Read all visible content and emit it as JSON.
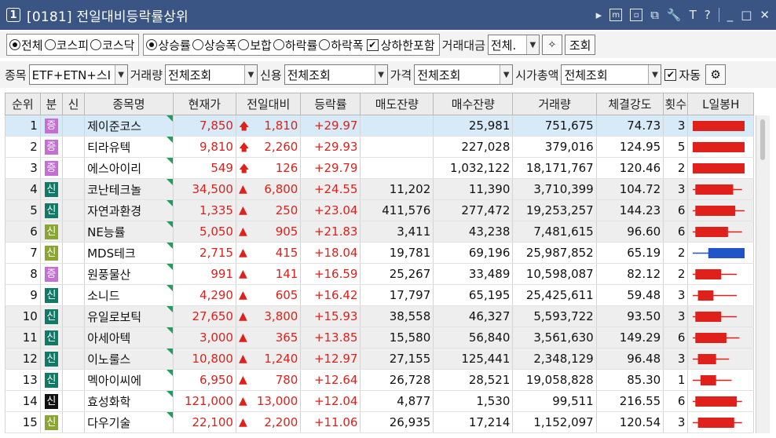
{
  "window": {
    "num": "1",
    "title": "[0181] 전일대비등락률상위"
  },
  "title_icons": [
    "▸",
    "m",
    "▫",
    "⧉",
    "🔧",
    "T",
    "?",
    "_",
    "□",
    "✕"
  ],
  "market": {
    "options": [
      "전체",
      "코스피",
      "코스닥"
    ],
    "selected": 0
  },
  "mode": {
    "options": [
      "상승률",
      "상승폭",
      "보합",
      "하락률",
      "하락폭"
    ],
    "selected": 0
  },
  "limit_check": {
    "label": "상하한포함",
    "checked": true
  },
  "volume_label": "거래대금",
  "volume_value": "전체.",
  "query_button": "조회",
  "filters": {
    "stock_label": "종목",
    "stock_value": "ETF+ETN+스I",
    "vol_label": "거래량",
    "vol_value": "전체조회",
    "credit_label": "신용",
    "credit_value": "전체조회",
    "price_label": "가격",
    "price_value": "전체조회",
    "cap_label": "시가총액",
    "cap_value": "전체조회",
    "auto_label": "자동",
    "auto_checked": true
  },
  "columns": [
    "순위",
    "분",
    "신",
    "종목명",
    "현재가",
    "전일대비",
    "등락률",
    "매도잔량",
    "매수잔량",
    "거래량",
    "체결강도",
    "횟수",
    "L일봉H"
  ],
  "colors": {
    "up_red": "#e0201a",
    "blue_candle": "#1f55c8",
    "badge_purple": "#c56fd6",
    "badge_teal": "#0f7a66",
    "badge_olive": "#8aa631",
    "badge_black": "#111111"
  },
  "rows": [
    {
      "rank": "1",
      "badge": "증",
      "badge_color": "#c56fd6",
      "name": "제이준코스",
      "price": "7,850",
      "arrow": "limit",
      "diff": "1,810",
      "rate": "+29.97",
      "ask": "",
      "bid": "25,981",
      "volume": "751,675",
      "strength": "74.73",
      "count": "3",
      "candle": {
        "color": "red",
        "lo": 0.0,
        "open": 0.0,
        "close": 1.0,
        "hi": 1.0
      }
    },
    {
      "rank": "2",
      "badge": "증",
      "badge_color": "#c56fd6",
      "name": "티라유텍",
      "price": "9,810",
      "arrow": "limit",
      "diff": "2,260",
      "rate": "+29.93",
      "ask": "",
      "bid": "227,028",
      "volume": "379,016",
      "strength": "124.95",
      "count": "5",
      "candle": {
        "color": "red",
        "lo": 0.0,
        "open": 0.0,
        "close": 1.0,
        "hi": 1.0
      }
    },
    {
      "rank": "3",
      "badge": "증",
      "badge_color": "#c56fd6",
      "name": "에스아이리",
      "price": "549",
      "arrow": "limit",
      "diff": "126",
      "rate": "+29.79",
      "ask": "",
      "bid": "1,032,122",
      "volume": "18,171,767",
      "strength": "120.46",
      "count": "2",
      "candle": {
        "color": "red",
        "lo": 0.0,
        "open": 0.0,
        "close": 1.0,
        "hi": 1.0
      }
    },
    {
      "rank": "4",
      "badge": "신",
      "badge_color": "#0f7a66",
      "name": "코난테크놀",
      "price": "34,500",
      "arrow": "up",
      "diff": "6,800",
      "rate": "+24.55",
      "ask": "11,202",
      "bid": "11,390",
      "volume": "3,710,399",
      "strength": "104.72",
      "count": "3",
      "candle": {
        "color": "red",
        "lo": 0.0,
        "open": 0.05,
        "close": 0.78,
        "hi": 0.95
      }
    },
    {
      "rank": "5",
      "badge": "신",
      "badge_color": "#0f7a66",
      "name": "자연과환경",
      "price": "1,335",
      "arrow": "up",
      "diff": "250",
      "rate": "+23.04",
      "ask": "411,576",
      "bid": "277,472",
      "volume": "19,253,257",
      "strength": "144.23",
      "count": "6",
      "candle": {
        "color": "red",
        "lo": 0.0,
        "open": 0.05,
        "close": 0.82,
        "hi": 1.0
      }
    },
    {
      "rank": "6",
      "badge": "신",
      "badge_color": "#8aa631",
      "name": "NE능률",
      "price": "5,050",
      "arrow": "up",
      "diff": "905",
      "rate": "+21.83",
      "ask": "3,411",
      "bid": "43,238",
      "volume": "7,481,615",
      "strength": "96.60",
      "count": "6",
      "candle": {
        "color": "red",
        "lo": 0.0,
        "open": 0.05,
        "close": 0.68,
        "hi": 0.95
      }
    },
    {
      "rank": "7",
      "badge": "신",
      "badge_color": "#8aa631",
      "name": "MDS테크",
      "price": "2,715",
      "arrow": "up",
      "diff": "415",
      "rate": "+18.04",
      "ask": "19,781",
      "bid": "69,196",
      "volume": "25,987,852",
      "strength": "65.19",
      "count": "2",
      "candle": {
        "color": "blue",
        "lo": 0.0,
        "open": 1.0,
        "close": 0.3,
        "hi": 1.0
      }
    },
    {
      "rank": "8",
      "badge": "증",
      "badge_color": "#c56fd6",
      "name": "원풍물산",
      "price": "991",
      "arrow": "up",
      "diff": "141",
      "rate": "+16.59",
      "ask": "25,267",
      "bid": "33,489",
      "volume": "10,598,087",
      "strength": "82.12",
      "count": "2",
      "candle": {
        "color": "red",
        "lo": 0.0,
        "open": 0.05,
        "close": 0.55,
        "hi": 0.85
      }
    },
    {
      "rank": "9",
      "badge": "신",
      "badge_color": "#0f7a66",
      "name": "소니드",
      "price": "4,290",
      "arrow": "up",
      "diff": "605",
      "rate": "+16.42",
      "ask": "17,797",
      "bid": "65,195",
      "volume": "25,425,611",
      "strength": "59.48",
      "count": "3",
      "candle": {
        "color": "red",
        "lo": 0.0,
        "open": 0.1,
        "close": 0.4,
        "hi": 0.85
      }
    },
    {
      "rank": "10",
      "badge": "신",
      "badge_color": "#0f7a66",
      "name": "유일로보틱",
      "price": "27,650",
      "arrow": "up",
      "diff": "3,800",
      "rate": "+15.93",
      "ask": "38,558",
      "bid": "46,327",
      "volume": "5,593,722",
      "strength": "93.50",
      "count": "3",
      "candle": {
        "color": "red",
        "lo": 0.0,
        "open": 0.05,
        "close": 0.55,
        "hi": 0.85
      }
    },
    {
      "rank": "11",
      "badge": "신",
      "badge_color": "#0f7a66",
      "name": "아세아텍",
      "price": "3,000",
      "arrow": "up",
      "diff": "365",
      "rate": "+13.85",
      "ask": "15,580",
      "bid": "56,840",
      "volume": "3,561,630",
      "strength": "149.29",
      "count": "6",
      "candle": {
        "color": "red",
        "lo": 0.0,
        "open": 0.05,
        "close": 0.65,
        "hi": 0.9
      }
    },
    {
      "rank": "12",
      "badge": "신",
      "badge_color": "#0f7a66",
      "name": "이노룰스",
      "price": "10,800",
      "arrow": "up",
      "diff": "1,240",
      "rate": "+12.97",
      "ask": "27,155",
      "bid": "125,441",
      "volume": "2,348,129",
      "strength": "96.48",
      "count": "3",
      "candle": {
        "color": "red",
        "lo": 0.0,
        "open": 0.1,
        "close": 0.45,
        "hi": 0.7
      }
    },
    {
      "rank": "13",
      "badge": "신",
      "badge_color": "#0f7a66",
      "name": "멕아이씨에",
      "price": "6,950",
      "arrow": "up",
      "diff": "780",
      "rate": "+12.64",
      "ask": "26,728",
      "bid": "28,521",
      "volume": "19,058,828",
      "strength": "85.30",
      "count": "1",
      "candle": {
        "color": "red",
        "lo": 0.0,
        "open": 0.15,
        "close": 0.45,
        "hi": 0.75
      }
    },
    {
      "rank": "14",
      "badge": "신",
      "badge_color": "#111111",
      "name": "효성화학",
      "price": "121,000",
      "arrow": "up",
      "diff": "13,000",
      "rate": "+12.04",
      "ask": "4,877",
      "bid": "1,530",
      "volume": "99,511",
      "strength": "216.55",
      "count": "6",
      "candle": {
        "color": "red",
        "lo": 0.0,
        "open": 0.05,
        "close": 0.85,
        "hi": 0.95
      }
    },
    {
      "rank": "15",
      "badge": "신",
      "badge_color": "#8aa631",
      "name": "다우기술",
      "price": "22,100",
      "arrow": "up",
      "diff": "2,200",
      "rate": "+11.06",
      "ask": "26,935",
      "bid": "17,214",
      "volume": "1,152,097",
      "strength": "120.54",
      "count": "3",
      "candle": {
        "color": "red",
        "lo": 0.0,
        "open": 0.1,
        "close": 0.8,
        "hi": 0.95
      }
    }
  ]
}
